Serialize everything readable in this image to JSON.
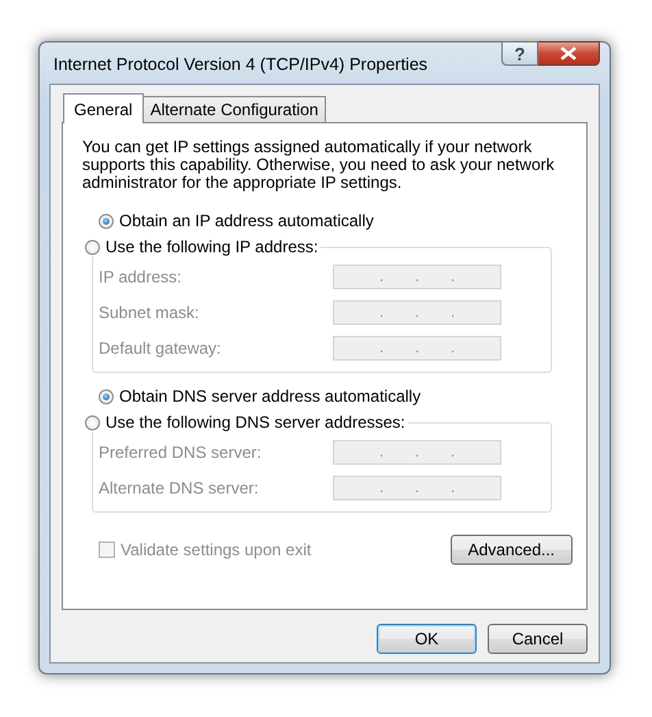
{
  "window": {
    "title": "Internet Protocol Version 4 (TCP/IPv4) Properties",
    "help_button": "?"
  },
  "tabs": [
    {
      "label": "General",
      "selected": true
    },
    {
      "label": "Alternate Configuration",
      "selected": false
    }
  ],
  "intro": "You can get IP settings assigned automatically if your network supports this capability. Otherwise, you need to ask your network administrator for the appropriate IP settings.",
  "ip_options": [
    {
      "label": "Obtain an IP address automatically",
      "selected": true
    },
    {
      "label": "Use the following IP address:",
      "selected": false
    }
  ],
  "ip_fields": [
    {
      "label": "IP address:",
      "separators": [
        ".",
        ".",
        "."
      ],
      "disabled": true
    },
    {
      "label": "Subnet mask:",
      "separators": [
        ".",
        ".",
        "."
      ],
      "disabled": true
    },
    {
      "label": "Default gateway:",
      "separators": [
        ".",
        ".",
        "."
      ],
      "disabled": true
    }
  ],
  "dns_options": [
    {
      "label": "Obtain DNS server address automatically",
      "selected": true
    },
    {
      "label": "Use the following DNS server addresses:",
      "selected": false
    }
  ],
  "dns_fields": [
    {
      "label": "Preferred DNS server:",
      "separators": [
        ".",
        ".",
        "."
      ],
      "disabled": true
    },
    {
      "label": "Alternate DNS server:",
      "separators": [
        ".",
        ".",
        "."
      ],
      "disabled": true
    }
  ],
  "validate": {
    "label": "Validate settings upon exit",
    "checked": false,
    "disabled": true
  },
  "advanced_button": "Advanced...",
  "buttons": [
    {
      "label": "OK",
      "default": true
    },
    {
      "label": "Cancel",
      "default": false
    }
  ]
}
